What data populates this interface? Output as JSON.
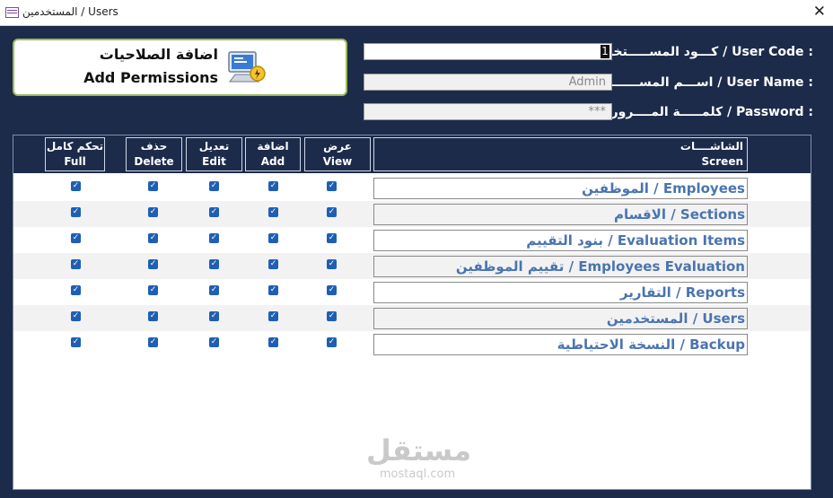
{
  "window": {
    "title": "المستخدمين / Users"
  },
  "add_permissions": {
    "arabic": "اضافة الصلاحيات",
    "english": "Add Permissions"
  },
  "form": {
    "user_code": {
      "label": "كـــود المســـــتخدم / User Code :",
      "value": "1"
    },
    "user_name": {
      "label": "اســـم المســــــتخدم / User Name :",
      "value": "Admin"
    },
    "password": {
      "label": "كلمـــــة المــــرور / Password :",
      "value": "***"
    }
  },
  "grid": {
    "headers": {
      "screen_ar": "الشاشــــات",
      "screen_en": "Screen",
      "view_ar": "عرض",
      "view_en": "View",
      "add_ar": "اضافة",
      "add_en": "Add",
      "edit_ar": "تعديل",
      "edit_en": "Edit",
      "delete_ar": "حذف",
      "delete_en": "Delete",
      "full_ar": "تحكم كامل",
      "full_en": "Full"
    },
    "rows": [
      {
        "screen": "الموظفين / Employees",
        "view": true,
        "add": true,
        "edit": true,
        "delete": true,
        "full": true
      },
      {
        "screen": "الاقسام / Sections",
        "view": true,
        "add": true,
        "edit": true,
        "delete": true,
        "full": true
      },
      {
        "screen": "بنود التقييم / Evaluation Items",
        "view": true,
        "add": true,
        "edit": true,
        "delete": true,
        "full": true
      },
      {
        "screen": "تقييم الموظفين / Employees Evaluation",
        "view": true,
        "add": true,
        "edit": true,
        "delete": true,
        "full": true
      },
      {
        "screen": "التقارير / Reports",
        "view": true,
        "add": true,
        "edit": true,
        "delete": true,
        "full": true
      },
      {
        "screen": "المستخدمين / Users",
        "view": true,
        "add": true,
        "edit": true,
        "delete": true,
        "full": true
      },
      {
        "screen": "النسخة الاحتياطية / Backup",
        "view": true,
        "add": true,
        "edit": true,
        "delete": true,
        "full": true
      }
    ]
  },
  "watermark": {
    "arabic": "مستقل",
    "latin": "mostaql.com"
  },
  "icons": {
    "window": "form-window-icon",
    "close": "close-icon",
    "permissions": "computer-lock-icon",
    "check": "checkbox-checked-icon"
  },
  "colors": {
    "background": "#1c2b4a",
    "accent_border": "#9bbb59",
    "screen_text": "#4a74b0",
    "checkbox": "#1e5fb4"
  }
}
